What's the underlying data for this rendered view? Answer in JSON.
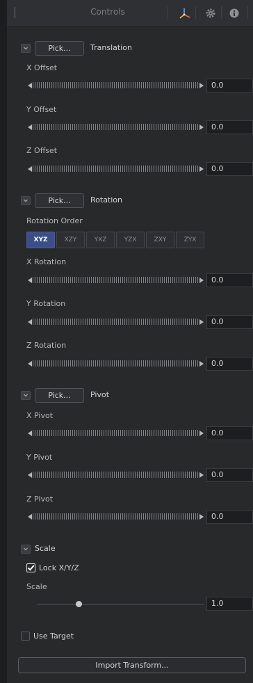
{
  "header": {
    "title": "Controls",
    "icons": [
      "transform-axes-icon",
      "gear-icon",
      "info-icon"
    ]
  },
  "translation": {
    "pick_label": "Pick...",
    "section_label": "Translation",
    "x": {
      "label": "X Offset",
      "value": "0.0"
    },
    "y": {
      "label": "Y Offset",
      "value": "0.0"
    },
    "z": {
      "label": "Z Offset",
      "value": "0.0"
    }
  },
  "rotation": {
    "pick_label": "Pick...",
    "section_label": "Rotation",
    "order_label": "Rotation Order",
    "orders": [
      "XYZ",
      "XZY",
      "YXZ",
      "YZX",
      "ZXY",
      "ZYX"
    ],
    "selected_order": "XYZ",
    "x": {
      "label": "X Rotation",
      "value": "0.0"
    },
    "y": {
      "label": "Y Rotation",
      "value": "0.0"
    },
    "z": {
      "label": "Z Rotation",
      "value": "0.0"
    }
  },
  "pivot": {
    "pick_label": "Pick...",
    "section_label": "Pivot",
    "x": {
      "label": "X Pivot",
      "value": "0.0"
    },
    "y": {
      "label": "Y Pivot",
      "value": "0.0"
    },
    "z": {
      "label": "Z Pivot",
      "value": "0.0"
    }
  },
  "scale": {
    "section_label": "Scale",
    "lock_label": "Lock X/Y/Z",
    "lock_checked": true,
    "label": "Scale",
    "value": "1.0",
    "slider_position": 0.25
  },
  "use_target": {
    "label": "Use Target",
    "checked": false
  },
  "import_button": {
    "label": "Import Transform..."
  },
  "colors": {
    "accent": "#3c4e88",
    "panel": "#28292b",
    "background": "#1c1d1f"
  }
}
